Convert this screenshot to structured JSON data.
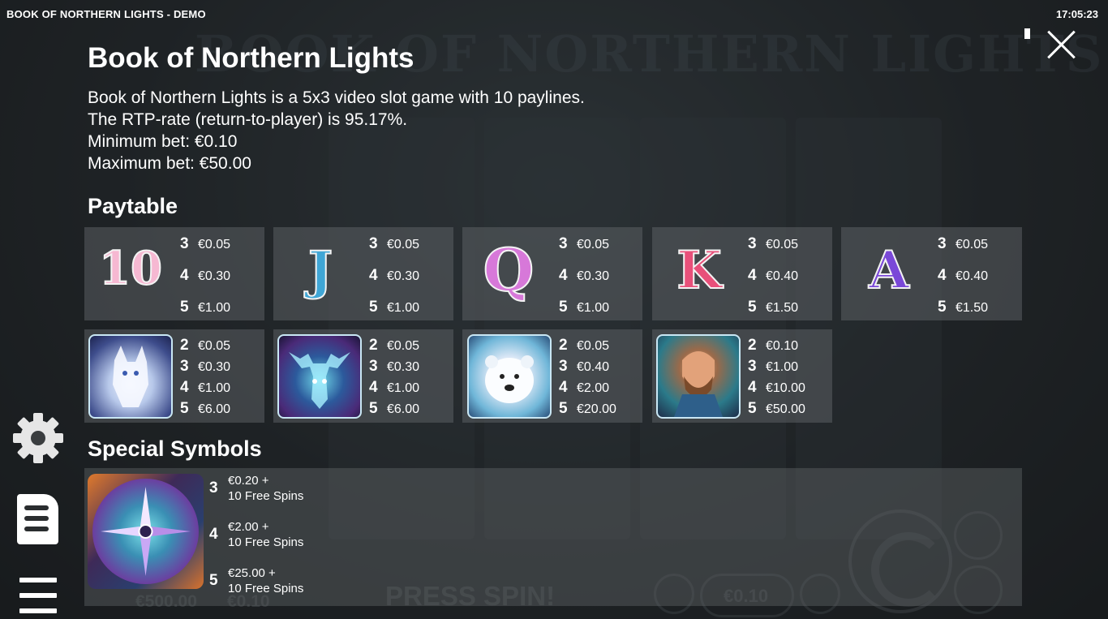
{
  "window": {
    "title": "BOOK OF NORTHERN LIGHTS - DEMO",
    "clock": "17:05:23"
  },
  "background": {
    "logo": "BOOK OF NORTHERN LIGHTS",
    "press_spin": "PRESS SPIN!",
    "balance": "€500.00",
    "last_win": "€0.10",
    "bet_display": "€0.10"
  },
  "info": {
    "title": "Book of Northern Lights",
    "lines": [
      "Book of Northern Lights is a 5x3 video slot game with 10 paylines.",
      "The RTP-rate (return-to-player) is 95.17%.",
      "Minimum bet: €0.10",
      "Maximum bet: €50.00"
    ]
  },
  "paytable": {
    "heading": "Paytable",
    "low_symbols": [
      {
        "symbol": "10",
        "color": "#f2a7c9",
        "pays": [
          {
            "n": "3",
            "v": "€0.05"
          },
          {
            "n": "4",
            "v": "€0.30"
          },
          {
            "n": "5",
            "v": "€1.00"
          }
        ]
      },
      {
        "symbol": "J",
        "color": "#3fa6d6",
        "pays": [
          {
            "n": "3",
            "v": "€0.05"
          },
          {
            "n": "4",
            "v": "€0.30"
          },
          {
            "n": "5",
            "v": "€1.00"
          }
        ]
      },
      {
        "symbol": "Q",
        "color": "#d778d9",
        "pays": [
          {
            "n": "3",
            "v": "€0.05"
          },
          {
            "n": "4",
            "v": "€0.30"
          },
          {
            "n": "5",
            "v": "€1.00"
          }
        ]
      },
      {
        "symbol": "K",
        "color": "#e8507a",
        "pays": [
          {
            "n": "3",
            "v": "€0.05"
          },
          {
            "n": "4",
            "v": "€0.40"
          },
          {
            "n": "5",
            "v": "€1.50"
          }
        ]
      },
      {
        "symbol": "A",
        "color": "#7a48d8",
        "pays": [
          {
            "n": "3",
            "v": "€0.05"
          },
          {
            "n": "4",
            "v": "€0.40"
          },
          {
            "n": "5",
            "v": "€1.50"
          }
        ]
      }
    ],
    "high_symbols": [
      {
        "symbol": "arctic-fox",
        "icon": "fox-icon",
        "pays": [
          {
            "n": "2",
            "v": "€0.05"
          },
          {
            "n": "3",
            "v": "€0.30"
          },
          {
            "n": "4",
            "v": "€1.00"
          },
          {
            "n": "5",
            "v": "€6.00"
          }
        ]
      },
      {
        "symbol": "moose",
        "icon": "moose-icon",
        "pays": [
          {
            "n": "2",
            "v": "€0.05"
          },
          {
            "n": "3",
            "v": "€0.30"
          },
          {
            "n": "4",
            "v": "€1.00"
          },
          {
            "n": "5",
            "v": "€6.00"
          }
        ]
      },
      {
        "symbol": "polar-bear",
        "icon": "polar-bear-icon",
        "pays": [
          {
            "n": "2",
            "v": "€0.05"
          },
          {
            "n": "3",
            "v": "€0.40"
          },
          {
            "n": "4",
            "v": "€2.00"
          },
          {
            "n": "5",
            "v": "€20.00"
          }
        ]
      },
      {
        "symbol": "explorer",
        "icon": "explorer-icon",
        "pays": [
          {
            "n": "2",
            "v": "€0.10"
          },
          {
            "n": "3",
            "v": "€1.00"
          },
          {
            "n": "4",
            "v": "€10.00"
          },
          {
            "n": "5",
            "v": "€50.00"
          }
        ]
      }
    ]
  },
  "special": {
    "heading": "Special Symbols",
    "symbol": "compass-scatter",
    "pays": [
      {
        "n": "3",
        "line1": "€0.20 +",
        "line2": "10 Free Spins"
      },
      {
        "n": "4",
        "line1": "€2.00 +",
        "line2": "10 Free Spins"
      },
      {
        "n": "5",
        "line1": "€25.00 +",
        "line2": "10 Free Spins"
      }
    ]
  },
  "colors": {
    "card": "#5f6467",
    "icon_border": "#c9e7f4"
  }
}
